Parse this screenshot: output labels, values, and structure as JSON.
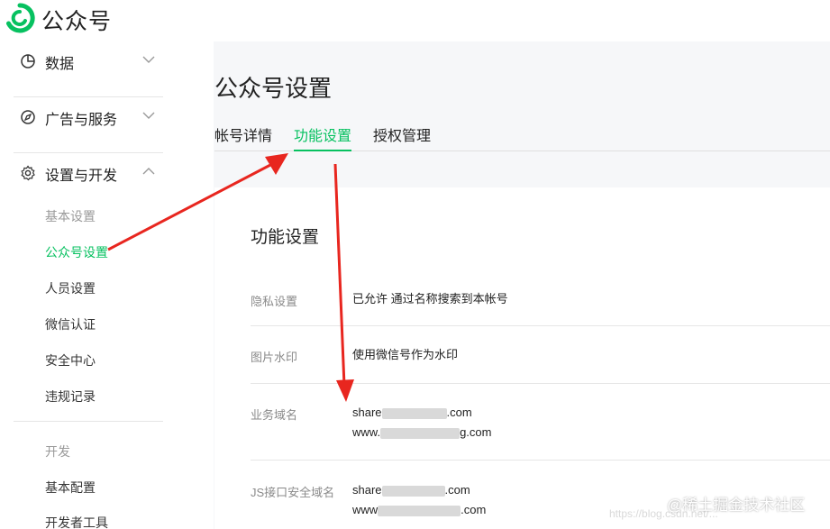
{
  "app": {
    "title": "公众号"
  },
  "sidebar": {
    "groups": [
      {
        "label": "数据",
        "icon": "pie-chart-icon",
        "expanded": false
      },
      {
        "label": "广告与服务",
        "icon": "compass-icon",
        "expanded": false
      },
      {
        "label": "设置与开发",
        "icon": "gear-icon",
        "expanded": true
      }
    ],
    "settings_category": "基本设置",
    "settings_items": [
      "公众号设置",
      "人员设置",
      "微信认证",
      "安全中心",
      "违规记录"
    ],
    "dev_category": "开发",
    "dev_items": [
      "基本配置",
      "开发者工具"
    ],
    "active_item": "公众号设置"
  },
  "main": {
    "title": "公众号设置",
    "tabs": [
      "帐号详情",
      "功能设置",
      "授权管理"
    ],
    "active_tab": "功能设置",
    "section_title": "功能设置",
    "rows": [
      {
        "label": "隐私设置",
        "value": "已允许 通过名称搜索到本帐号"
      },
      {
        "label": "图片水印",
        "value": "使用微信号作为水印"
      },
      {
        "label": "业务域名",
        "lines": [
          {
            "prefix": "share",
            "suffix": ".com"
          },
          {
            "prefix": "www.",
            "suffix": "g.com"
          }
        ]
      },
      {
        "label": "JS接口安全域名",
        "lines": [
          {
            "prefix": "share",
            "suffix": ".com"
          },
          {
            "prefix": "www",
            "suffix": ".com"
          }
        ]
      }
    ]
  },
  "watermark": {
    "text": "@稀土掘金技术社区",
    "faint": "https://blog.csdn.net/..."
  },
  "colors": {
    "accent": "#07c160",
    "arrow": "#e8261f",
    "text": "#222222",
    "muted": "#8a8a8a"
  }
}
